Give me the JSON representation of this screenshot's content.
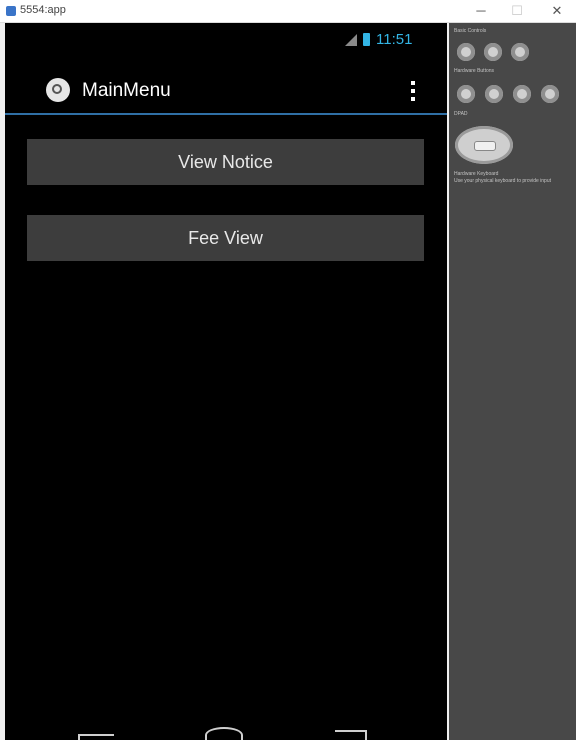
{
  "window": {
    "title": "5554:app",
    "minimize_glyph": "─",
    "maximize_glyph": "☐",
    "close_glyph": "✕"
  },
  "status_bar": {
    "time": "11:51",
    "icons": [
      "signal-icon",
      "battery-icon"
    ]
  },
  "action_bar": {
    "title": "MainMenu",
    "logo_icon": "app-logo-icon",
    "overflow_icon": "overflow-menu-icon"
  },
  "buttons": [
    {
      "label": "View Notice"
    },
    {
      "label": "Fee View"
    }
  ],
  "nav_bar": {
    "icons": [
      "back-icon",
      "home-icon",
      "recent-apps-icon"
    ]
  },
  "controls": {
    "hardware_label": "Basic Controls",
    "media_label": "Hardware Buttons",
    "dpad_label": "DPAD",
    "keyboard_label": "Hardware Keyboard",
    "keyboard_hint": "Use your physical keyboard to provide input"
  },
  "colors": {
    "accent": "#33b5e5",
    "button_bg": "#3d3d3d",
    "screen_bg": "#000000",
    "panel_bg": "#484848",
    "divider": "#2f6fa5"
  }
}
